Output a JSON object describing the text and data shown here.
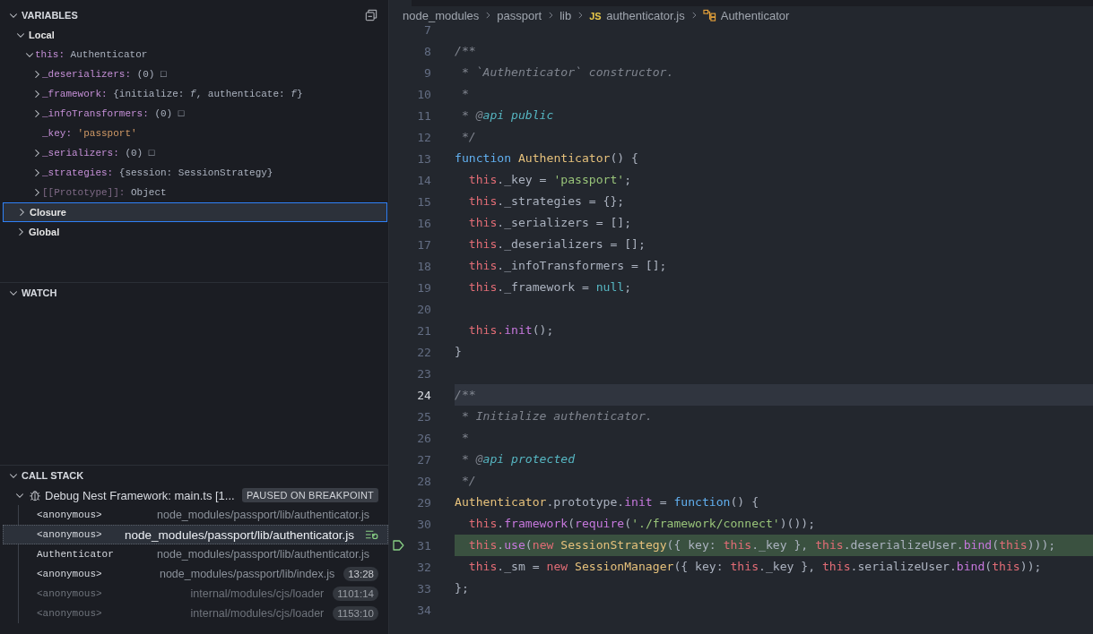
{
  "sidebar": {
    "variables": {
      "title": "VARIABLES",
      "expanded": true,
      "scopes": [
        {
          "name": "Local",
          "kind": "scope",
          "expandable": true,
          "expanded": true,
          "selected": false,
          "children": [
            {
              "name": "this:",
              "value": "Authenticator",
              "kind": "object",
              "expandable": true,
              "expanded": true,
              "selected": false,
              "children": [
                {
                  "name": "_deserializers:",
                  "value": "(0) □",
                  "kind": "object",
                  "expandable": true,
                  "expanded": false,
                  "selected": false
                },
                {
                  "name": "_framework:",
                  "value": "{initialize: *f*, authenticate: *f*}",
                  "kind": "object",
                  "expandable": true,
                  "expanded": false,
                  "selected": false
                },
                {
                  "name": "_infoTransformers:",
                  "value": "(0) □",
                  "kind": "object",
                  "expandable": true,
                  "expanded": false,
                  "selected": false
                },
                {
                  "name": "_key:",
                  "value": "'passport'",
                  "kind": "string",
                  "expandable": false,
                  "selected": false
                },
                {
                  "name": "_serializers:",
                  "value": "(0) □",
                  "kind": "object",
                  "expandable": true,
                  "expanded": false,
                  "selected": false
                },
                {
                  "name": "_strategies:",
                  "value": "{session: SessionStrategy}",
                  "kind": "object",
                  "expandable": true,
                  "expanded": false,
                  "selected": false
                },
                {
                  "name": "[[Prototype]]:",
                  "value": "Object",
                  "kind": "internal",
                  "expandable": true,
                  "expanded": false,
                  "selected": false
                }
              ]
            }
          ]
        },
        {
          "name": "Closure",
          "kind": "scope",
          "expandable": true,
          "expanded": false,
          "selected": true
        },
        {
          "name": "Global",
          "kind": "scope",
          "expandable": true,
          "expanded": false,
          "selected": false
        }
      ]
    },
    "watch": {
      "title": "WATCH",
      "expanded": true
    },
    "call_stack": {
      "title": "CALL STACK",
      "expanded": true,
      "session": {
        "label": "Debug Nest Framework: main.ts [1...",
        "status": "PAUSED ON BREAKPOINT",
        "expanded": true
      },
      "frames": [
        {
          "function": "<anonymous>",
          "file": "node_modules/passport/lib/authenticator.js",
          "selected": false,
          "dimmed": false
        },
        {
          "function": "<anonymous>",
          "file": "node_modules/passport/lib/authenticator.js",
          "selected": true,
          "dimmed": false
        },
        {
          "function": "Authenticator",
          "file": "node_modules/passport/lib/authenticator.js",
          "selected": false,
          "dimmed": false
        },
        {
          "function": "<anonymous>",
          "file": "node_modules/passport/lib/index.js",
          "line": "13:28",
          "selected": false,
          "dimmed": false
        },
        {
          "function": "<anonymous>",
          "file": "internal/modules/cjs/loader",
          "line": "1101:14",
          "selected": false,
          "dimmed": true
        },
        {
          "function": "<anonymous>",
          "file": "internal/modules/cjs/loader",
          "line": "1153:10",
          "selected": false,
          "dimmed": true
        }
      ]
    }
  },
  "editor": {
    "breadcrumbs": [
      {
        "label": "node_modules",
        "kind": "folder"
      },
      {
        "label": "passport",
        "kind": "folder"
      },
      {
        "label": "lib",
        "kind": "folder"
      },
      {
        "label": "authenticator.js",
        "kind": "file",
        "badge": "JS"
      },
      {
        "label": "Authenticator",
        "kind": "symbol"
      }
    ],
    "lines": [
      {
        "number": "7",
        "cursor": false,
        "paused": false
      },
      {
        "number": "8",
        "cursor": false,
        "paused": false,
        "tokens": [
          {
            "kind": "comment",
            "text": "/**"
          }
        ]
      },
      {
        "number": "9",
        "cursor": false,
        "paused": false,
        "tokens": [
          {
            "kind": "comment",
            "text": " * `Authenticator` constructor."
          }
        ]
      },
      {
        "number": "10",
        "cursor": false,
        "paused": false,
        "tokens": [
          {
            "kind": "comment",
            "text": " *"
          }
        ]
      },
      {
        "number": "11",
        "cursor": false,
        "paused": false,
        "tokens": [
          {
            "kind": "comment",
            "text": " * @"
          },
          {
            "kind": "doctag",
            "text": "api public"
          }
        ]
      },
      {
        "number": "12",
        "cursor": false,
        "paused": false,
        "tokens": [
          {
            "kind": "comment",
            "text": " */"
          }
        ]
      },
      {
        "number": "13",
        "cursor": false,
        "paused": false,
        "tokens": [
          {
            "kind": "keyword",
            "text": "function"
          },
          {
            "kind": "class",
            "text": " Authenticator"
          },
          {
            "kind": "plain",
            "text": "() {"
          }
        ]
      },
      {
        "number": "14",
        "cursor": false,
        "paused": false,
        "tokens": [
          {
            "kind": "this",
            "text": "  this"
          },
          {
            "kind": "plain",
            "text": "._key = "
          },
          {
            "kind": "string",
            "text": "'passport'"
          },
          {
            "kind": "plain",
            "text": ";"
          }
        ]
      },
      {
        "number": "15",
        "cursor": false,
        "paused": false,
        "tokens": [
          {
            "kind": "this",
            "text": "  this"
          },
          {
            "kind": "plain",
            "text": "._strategies = {};"
          }
        ]
      },
      {
        "number": "16",
        "cursor": false,
        "paused": false,
        "tokens": [
          {
            "kind": "this",
            "text": "  this"
          },
          {
            "kind": "plain",
            "text": "._serializers = [];"
          }
        ]
      },
      {
        "number": "17",
        "cursor": false,
        "paused": false,
        "tokens": [
          {
            "kind": "this",
            "text": "  this"
          },
          {
            "kind": "plain",
            "text": "._deserializers = [];"
          }
        ]
      },
      {
        "number": "18",
        "cursor": false,
        "paused": false,
        "tokens": [
          {
            "kind": "this",
            "text": "  this"
          },
          {
            "kind": "plain",
            "text": "._infoTransformers = [];"
          }
        ]
      },
      {
        "number": "19",
        "cursor": false,
        "paused": false,
        "tokens": [
          {
            "kind": "this",
            "text": "  this"
          },
          {
            "kind": "plain",
            "text": "._framework = "
          },
          {
            "kind": "constant",
            "text": "null"
          },
          {
            "kind": "plain",
            "text": ";"
          }
        ]
      },
      {
        "number": "20",
        "cursor": false,
        "paused": false
      },
      {
        "number": "21",
        "cursor": false,
        "paused": false,
        "tokens": [
          {
            "kind": "this",
            "text": "  this."
          },
          {
            "kind": "method",
            "text": "init"
          },
          {
            "kind": "plain",
            "text": "();"
          }
        ]
      },
      {
        "number": "22",
        "cursor": false,
        "paused": false,
        "tokens": [
          {
            "kind": "plain",
            "text": "}"
          }
        ]
      },
      {
        "number": "23",
        "cursor": false,
        "paused": false
      },
      {
        "number": "24",
        "cursor": true,
        "paused": false,
        "tokens": [
          {
            "kind": "comment",
            "text": "/**"
          }
        ]
      },
      {
        "number": "25",
        "cursor": false,
        "paused": false,
        "tokens": [
          {
            "kind": "comment",
            "text": " * Initialize authenticator."
          }
        ]
      },
      {
        "number": "26",
        "cursor": false,
        "paused": false,
        "tokens": [
          {
            "kind": "comment",
            "text": " *"
          }
        ]
      },
      {
        "number": "27",
        "cursor": false,
        "paused": false,
        "tokens": [
          {
            "kind": "comment",
            "text": " * @"
          },
          {
            "kind": "doctag",
            "text": "api protected"
          }
        ]
      },
      {
        "number": "28",
        "cursor": false,
        "paused": false,
        "tokens": [
          {
            "kind": "comment",
            "text": " */"
          }
        ]
      },
      {
        "number": "29",
        "cursor": false,
        "paused": false,
        "tokens": [
          {
            "kind": "class",
            "text": "Authenticator"
          },
          {
            "kind": "plain",
            "text": ".prototype."
          },
          {
            "kind": "method",
            "text": "init"
          },
          {
            "kind": "plain",
            "text": " = "
          },
          {
            "kind": "keyword",
            "text": "function"
          },
          {
            "kind": "plain",
            "text": "() {"
          }
        ]
      },
      {
        "number": "30",
        "cursor": false,
        "paused": false,
        "tokens": [
          {
            "kind": "this",
            "text": "  this"
          },
          {
            "kind": "plain",
            "text": "."
          },
          {
            "kind": "method",
            "text": "framework"
          },
          {
            "kind": "plain",
            "text": "("
          },
          {
            "kind": "method",
            "text": "require"
          },
          {
            "kind": "plain",
            "text": "("
          },
          {
            "kind": "string",
            "text": "'./framework/connect'"
          },
          {
            "kind": "plain",
            "text": ")());"
          }
        ]
      },
      {
        "number": "31",
        "cursor": false,
        "paused": true,
        "tokens": [
          {
            "kind": "this",
            "text": "  this"
          },
          {
            "kind": "plain",
            "text": "."
          },
          {
            "kind": "method",
            "text": "use"
          },
          {
            "kind": "plain",
            "text": "("
          },
          {
            "kind": "operator",
            "text": "new"
          },
          {
            "kind": "class",
            "text": " SessionStrategy"
          },
          {
            "kind": "plain",
            "text": "({ key: "
          },
          {
            "kind": "this",
            "text": "this"
          },
          {
            "kind": "plain",
            "text": "._key }, "
          },
          {
            "kind": "this",
            "text": "this"
          },
          {
            "kind": "plain",
            "text": ".deserializeUser."
          },
          {
            "kind": "method",
            "text": "bind"
          },
          {
            "kind": "plain",
            "text": "("
          },
          {
            "kind": "this",
            "text": "this"
          },
          {
            "kind": "plain",
            "text": ")));"
          }
        ]
      },
      {
        "number": "32",
        "cursor": false,
        "paused": false,
        "tokens": [
          {
            "kind": "this",
            "text": "  this"
          },
          {
            "kind": "plain",
            "text": "._sm = "
          },
          {
            "kind": "operator",
            "text": "new"
          },
          {
            "kind": "class",
            "text": " SessionManager"
          },
          {
            "kind": "plain",
            "text": "({ key: "
          },
          {
            "kind": "this",
            "text": "this"
          },
          {
            "kind": "plain",
            "text": "._key }, "
          },
          {
            "kind": "this",
            "text": "this"
          },
          {
            "kind": "plain",
            "text": ".serializeUser."
          },
          {
            "kind": "method",
            "text": "bind"
          },
          {
            "kind": "plain",
            "text": "("
          },
          {
            "kind": "this",
            "text": "this"
          },
          {
            "kind": "plain",
            "text": "));"
          }
        ]
      },
      {
        "number": "33",
        "cursor": false,
        "paused": false,
        "tokens": [
          {
            "kind": "plain",
            "text": "};"
          }
        ]
      },
      {
        "number": "34",
        "cursor": false,
        "paused": false
      }
    ]
  }
}
